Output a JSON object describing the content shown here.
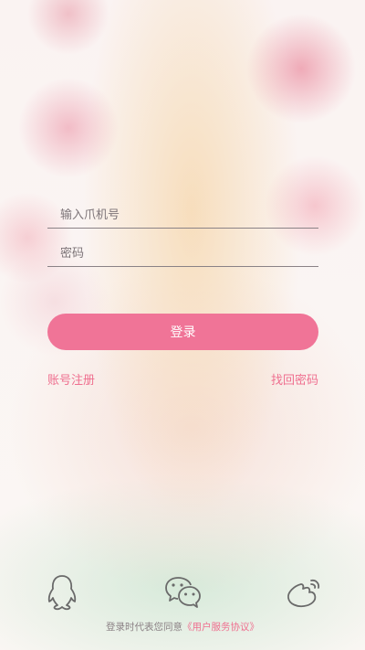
{
  "form": {
    "phone_placeholder": "输入爪机号",
    "password_placeholder": "密码",
    "login_label": "登录"
  },
  "links": {
    "register": "账号注册",
    "forgot_password": "找回密码"
  },
  "social": [
    "qq-icon",
    "wechat-icon",
    "weibo-icon"
  ],
  "agreement": {
    "text": "登录时代表您同意",
    "link": "《用户服务协议》"
  },
  "colors": {
    "accent": "#f07497",
    "link": "#ef6f8f",
    "line": "#8a8286",
    "icon_stroke": "#6a6a6a"
  }
}
